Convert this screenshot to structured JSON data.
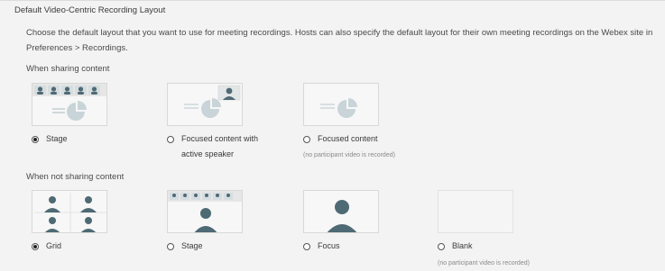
{
  "section_title": "Default Video-Centric Recording Layout",
  "description": "Choose the default layout that you want to use for meeting recordings. Hosts can also specify the default layout for their own meeting recordings on the Webex site in Preferences > Recordings.",
  "sharing": {
    "label": "When sharing content",
    "options": [
      {
        "label": "Stage",
        "checked": true
      },
      {
        "label_line1": "Focused content with",
        "label_line2": "active speaker",
        "checked": false
      },
      {
        "label": "Focused content",
        "note": "(no participant video is recorded)",
        "checked": false
      }
    ]
  },
  "not_sharing": {
    "label": "When not sharing content",
    "options": [
      {
        "label": "Grid",
        "checked": true
      },
      {
        "label": "Stage",
        "checked": false
      },
      {
        "label": "Focus",
        "checked": false
      },
      {
        "label": "Blank",
        "note": "(no participant video is recorded)",
        "checked": false
      }
    ]
  }
}
